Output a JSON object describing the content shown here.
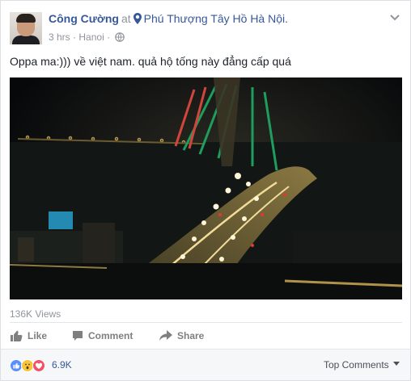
{
  "post": {
    "author": "Công Cường",
    "at_word": "at",
    "location": "Phú Thượng Tây Hồ Hà Nội.",
    "time": "3 hrs",
    "meta_sep": "·",
    "place": "Hanoi",
    "meta_sep2": "·",
    "text": "Oppa ma:))) về việt nam. quả hộ tống này đẳng cấp quá"
  },
  "video": {
    "views": "136K Views"
  },
  "actions": {
    "like": "Like",
    "comment": "Comment",
    "share": "Share"
  },
  "reactions": {
    "count": "6.9K",
    "types": [
      "like",
      "wow",
      "love"
    ],
    "colors": {
      "like": "#5890ff",
      "wow": "#f7c43a",
      "love": "#f25268"
    }
  },
  "top_comments": "Top Comments"
}
